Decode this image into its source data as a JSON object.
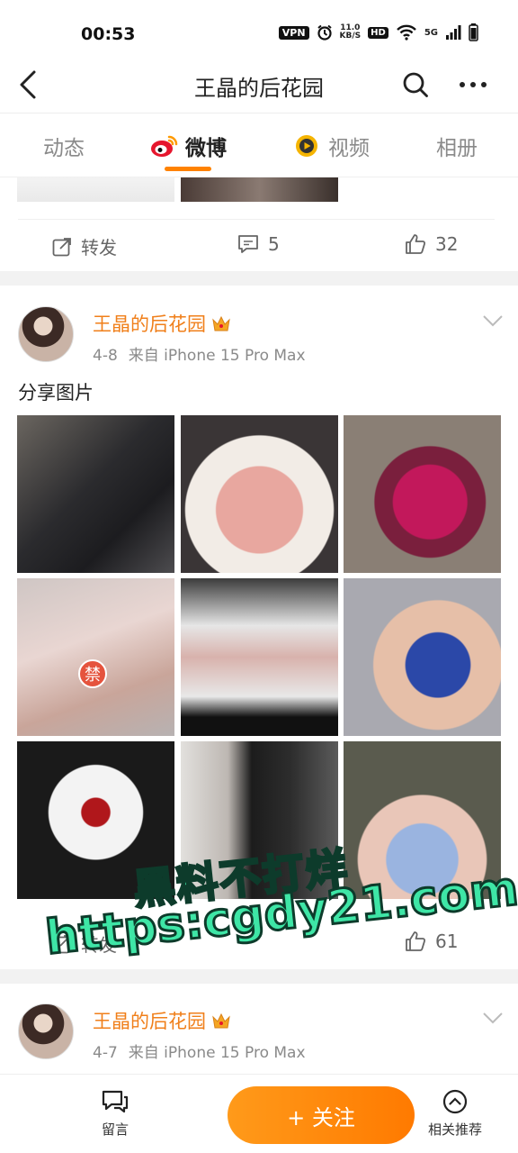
{
  "status_bar": {
    "time": "00:53",
    "vpn": "VPN",
    "speed_top": "11.0",
    "speed_bottom": "KB/S",
    "hd": "HD",
    "network": "5G"
  },
  "nav": {
    "title": "王晶的后花园",
    "icons": [
      "back-arrow-icon",
      "search-icon",
      "more-icon"
    ]
  },
  "tabs": {
    "items": [
      "动态",
      "微博",
      "视频",
      "相册"
    ],
    "active": "微博",
    "accent": "#ff8200"
  },
  "prev_post": {
    "actions": {
      "repost": "转发",
      "comments": "5",
      "likes": "32"
    }
  },
  "post1": {
    "author": "王晶的后花园",
    "date": "4-8",
    "source": "来自 iPhone 15 Pro Max",
    "text": "分享图片",
    "image_sticker": "禁",
    "actions": {
      "repost": "转发",
      "likes": "61"
    }
  },
  "post2": {
    "author": "王晶的后花园",
    "date": "4-7",
    "source": "来自 iPhone 15 Pro Max"
  },
  "bottom_bar": {
    "comment": "留言",
    "follow": "+ 关注",
    "related": "相关推荐"
  },
  "watermark": {
    "line1": "黑料不打烊",
    "line2": "https:cgdy21.com"
  },
  "colors": {
    "author": "#f07f1a",
    "follow_button": "#ff8200",
    "watermark": "#3ee6a6"
  }
}
